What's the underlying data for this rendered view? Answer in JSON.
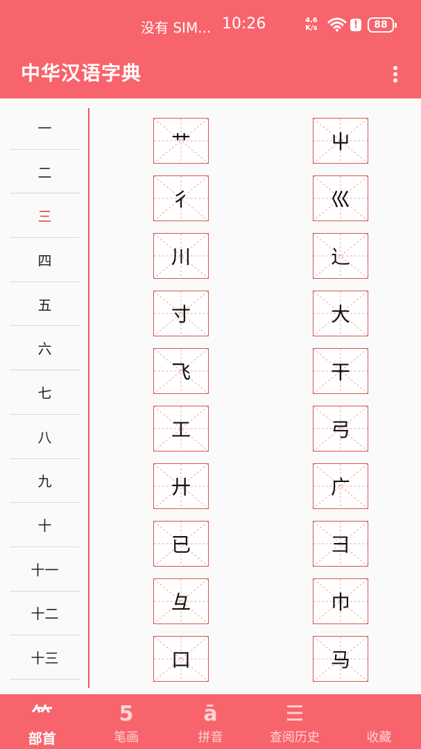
{
  "status": {
    "carrier": "没有 SIM...",
    "time": "10:26",
    "speed_top": "4.6",
    "speed_bottom": "K/s",
    "battery": "88"
  },
  "app": {
    "title": "中华汉语字典"
  },
  "strokes": [
    "一",
    "二",
    "三",
    "四",
    "五",
    "六",
    "七",
    "八",
    "九",
    "十",
    "十一",
    "十二",
    "十三"
  ],
  "active_stroke": "三",
  "radicals_left": [
    "艹",
    "彳",
    "川",
    "寸",
    "飞",
    "工",
    "廾",
    "已",
    "彑",
    "口"
  ],
  "radicals_right": [
    "屮",
    "巛",
    "辶",
    "大",
    "干",
    "弓",
    "广",
    "彐",
    "巾",
    "马"
  ],
  "nav": [
    {
      "icon": "radical-icon",
      "glyph": "⺮",
      "label": "部首"
    },
    {
      "icon": "stroke-count-icon",
      "glyph": "5",
      "label": "笔画"
    },
    {
      "icon": "pinyin-icon",
      "glyph": "ā",
      "label": "拼音"
    },
    {
      "icon": "history-icon",
      "glyph": "☰",
      "label": "查阅历史"
    },
    {
      "icon": "favorite-icon",
      "glyph": "",
      "label": "收藏"
    }
  ],
  "colors": {
    "accent": "#f8646c",
    "active_text": "#e53935",
    "grid_border": "#d9534f"
  }
}
